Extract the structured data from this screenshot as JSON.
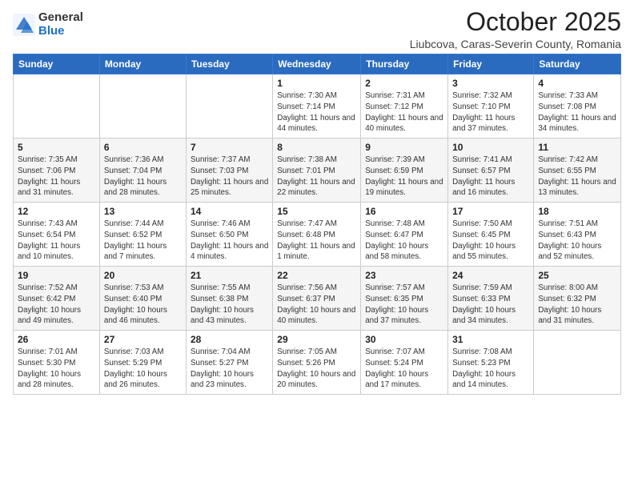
{
  "header": {
    "logo_general": "General",
    "logo_blue": "Blue",
    "title": "October 2025",
    "subtitle": "Liubcova, Caras-Severin County, Romania"
  },
  "weekdays": [
    "Sunday",
    "Monday",
    "Tuesday",
    "Wednesday",
    "Thursday",
    "Friday",
    "Saturday"
  ],
  "weeks": [
    [
      {
        "day": "",
        "info": ""
      },
      {
        "day": "",
        "info": ""
      },
      {
        "day": "",
        "info": ""
      },
      {
        "day": "1",
        "info": "Sunrise: 7:30 AM\nSunset: 7:14 PM\nDaylight: 11 hours\nand 44 minutes."
      },
      {
        "day": "2",
        "info": "Sunrise: 7:31 AM\nSunset: 7:12 PM\nDaylight: 11 hours\nand 40 minutes."
      },
      {
        "day": "3",
        "info": "Sunrise: 7:32 AM\nSunset: 7:10 PM\nDaylight: 11 hours\nand 37 minutes."
      },
      {
        "day": "4",
        "info": "Sunrise: 7:33 AM\nSunset: 7:08 PM\nDaylight: 11 hours\nand 34 minutes."
      }
    ],
    [
      {
        "day": "5",
        "info": "Sunrise: 7:35 AM\nSunset: 7:06 PM\nDaylight: 11 hours\nand 31 minutes."
      },
      {
        "day": "6",
        "info": "Sunrise: 7:36 AM\nSunset: 7:04 PM\nDaylight: 11 hours\nand 28 minutes."
      },
      {
        "day": "7",
        "info": "Sunrise: 7:37 AM\nSunset: 7:03 PM\nDaylight: 11 hours\nand 25 minutes."
      },
      {
        "day": "8",
        "info": "Sunrise: 7:38 AM\nSunset: 7:01 PM\nDaylight: 11 hours\nand 22 minutes."
      },
      {
        "day": "9",
        "info": "Sunrise: 7:39 AM\nSunset: 6:59 PM\nDaylight: 11 hours\nand 19 minutes."
      },
      {
        "day": "10",
        "info": "Sunrise: 7:41 AM\nSunset: 6:57 PM\nDaylight: 11 hours\nand 16 minutes."
      },
      {
        "day": "11",
        "info": "Sunrise: 7:42 AM\nSunset: 6:55 PM\nDaylight: 11 hours\nand 13 minutes."
      }
    ],
    [
      {
        "day": "12",
        "info": "Sunrise: 7:43 AM\nSunset: 6:54 PM\nDaylight: 11 hours\nand 10 minutes."
      },
      {
        "day": "13",
        "info": "Sunrise: 7:44 AM\nSunset: 6:52 PM\nDaylight: 11 hours\nand 7 minutes."
      },
      {
        "day": "14",
        "info": "Sunrise: 7:46 AM\nSunset: 6:50 PM\nDaylight: 11 hours\nand 4 minutes."
      },
      {
        "day": "15",
        "info": "Sunrise: 7:47 AM\nSunset: 6:48 PM\nDaylight: 11 hours\nand 1 minute."
      },
      {
        "day": "16",
        "info": "Sunrise: 7:48 AM\nSunset: 6:47 PM\nDaylight: 10 hours\nand 58 minutes."
      },
      {
        "day": "17",
        "info": "Sunrise: 7:50 AM\nSunset: 6:45 PM\nDaylight: 10 hours\nand 55 minutes."
      },
      {
        "day": "18",
        "info": "Sunrise: 7:51 AM\nSunset: 6:43 PM\nDaylight: 10 hours\nand 52 minutes."
      }
    ],
    [
      {
        "day": "19",
        "info": "Sunrise: 7:52 AM\nSunset: 6:42 PM\nDaylight: 10 hours\nand 49 minutes."
      },
      {
        "day": "20",
        "info": "Sunrise: 7:53 AM\nSunset: 6:40 PM\nDaylight: 10 hours\nand 46 minutes."
      },
      {
        "day": "21",
        "info": "Sunrise: 7:55 AM\nSunset: 6:38 PM\nDaylight: 10 hours\nand 43 minutes."
      },
      {
        "day": "22",
        "info": "Sunrise: 7:56 AM\nSunset: 6:37 PM\nDaylight: 10 hours\nand 40 minutes."
      },
      {
        "day": "23",
        "info": "Sunrise: 7:57 AM\nSunset: 6:35 PM\nDaylight: 10 hours\nand 37 minutes."
      },
      {
        "day": "24",
        "info": "Sunrise: 7:59 AM\nSunset: 6:33 PM\nDaylight: 10 hours\nand 34 minutes."
      },
      {
        "day": "25",
        "info": "Sunrise: 8:00 AM\nSunset: 6:32 PM\nDaylight: 10 hours\nand 31 minutes."
      }
    ],
    [
      {
        "day": "26",
        "info": "Sunrise: 7:01 AM\nSunset: 5:30 PM\nDaylight: 10 hours\nand 28 minutes."
      },
      {
        "day": "27",
        "info": "Sunrise: 7:03 AM\nSunset: 5:29 PM\nDaylight: 10 hours\nand 26 minutes."
      },
      {
        "day": "28",
        "info": "Sunrise: 7:04 AM\nSunset: 5:27 PM\nDaylight: 10 hours\nand 23 minutes."
      },
      {
        "day": "29",
        "info": "Sunrise: 7:05 AM\nSunset: 5:26 PM\nDaylight: 10 hours\nand 20 minutes."
      },
      {
        "day": "30",
        "info": "Sunrise: 7:07 AM\nSunset: 5:24 PM\nDaylight: 10 hours\nand 17 minutes."
      },
      {
        "day": "31",
        "info": "Sunrise: 7:08 AM\nSunset: 5:23 PM\nDaylight: 10 hours\nand 14 minutes."
      },
      {
        "day": "",
        "info": ""
      }
    ]
  ]
}
